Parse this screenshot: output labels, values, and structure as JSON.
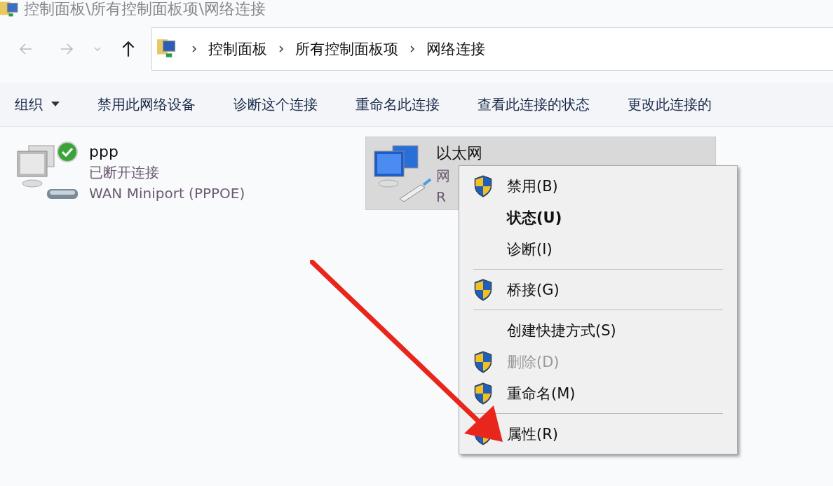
{
  "window": {
    "title": "控制面板\\所有控制面板项\\网络连接"
  },
  "nav": {
    "back": {
      "disabled": true
    },
    "forward": {
      "disabled": true
    },
    "up": {
      "disabled": false
    }
  },
  "breadcrumbs": [
    "控制面板",
    "所有控制面板项",
    "网络连接"
  ],
  "toolbar": [
    {
      "label": "组织",
      "dropdown": true
    },
    {
      "label": "禁用此网络设备",
      "dropdown": false
    },
    {
      "label": "诊断这个连接",
      "dropdown": false
    },
    {
      "label": "重命名此连接",
      "dropdown": false
    },
    {
      "label": "查看此连接的状态",
      "dropdown": false
    },
    {
      "label": "更改此连接的",
      "dropdown": false
    }
  ],
  "connections": [
    {
      "name": "ppp",
      "status": "已断开连接",
      "device": "WAN Miniport (PPPOE)",
      "selected": false,
      "connected": true,
      "kind": "dialup"
    },
    {
      "name": "以太网",
      "status": "网",
      "device": "R",
      "selected": true,
      "connected": false,
      "kind": "ethernet"
    }
  ],
  "context_menu": [
    {
      "kind": "item",
      "label": "禁用(B)",
      "shield": true,
      "default": false,
      "disabled": false
    },
    {
      "kind": "item",
      "label": "状态(U)",
      "shield": false,
      "default": true,
      "disabled": false
    },
    {
      "kind": "item",
      "label": "诊断(I)",
      "shield": false,
      "default": false,
      "disabled": false
    },
    {
      "kind": "separator"
    },
    {
      "kind": "item",
      "label": "桥接(G)",
      "shield": true,
      "default": false,
      "disabled": false
    },
    {
      "kind": "separator"
    },
    {
      "kind": "item",
      "label": "创建快捷方式(S)",
      "shield": false,
      "default": false,
      "disabled": false
    },
    {
      "kind": "item",
      "label": "删除(D)",
      "shield": true,
      "default": false,
      "disabled": true
    },
    {
      "kind": "item",
      "label": "重命名(M)",
      "shield": true,
      "default": false,
      "disabled": false
    },
    {
      "kind": "separator"
    },
    {
      "kind": "item",
      "label": "属性(R)",
      "shield": true,
      "default": false,
      "disabled": false
    }
  ]
}
